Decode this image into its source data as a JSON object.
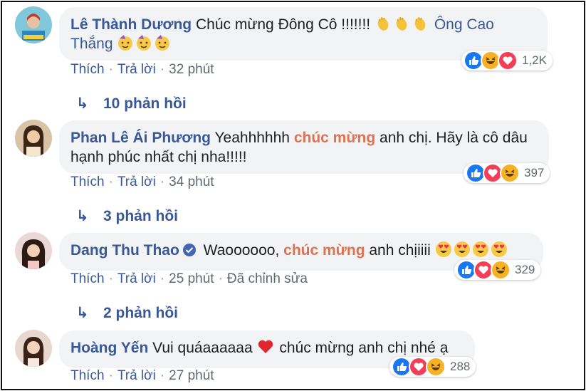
{
  "comments": [
    {
      "author": "Lê Thành Dương",
      "text_1": "Chúc mừng Đông Cô !!!!!!! ",
      "emoji_1": "clapping-hands-x3",
      "mention": "Ông Cao Thắng",
      "emoji_2": "smiling-party-face-x3",
      "like": "Thích",
      "reply": "Trả lời",
      "time": "32 phút",
      "reactions": [
        "like",
        "haha",
        "love"
      ],
      "reaction_count": "1,2K",
      "replies": "10 phản hồi"
    },
    {
      "author": "Phan Lê Ái Phương",
      "text_1": "Yeahhhhhh ",
      "highlight": "chúc mừng",
      "text_2": " anh chị. Hãy là cô dâu hạnh phúc nhất chị nha!!!!!",
      "like": "Thích",
      "reply": "Trả lời",
      "time": "34 phút",
      "reactions": [
        "like",
        "love",
        "haha"
      ],
      "reaction_count": "397",
      "replies": "3 phản hồi"
    },
    {
      "author": "Dang Thu Thao",
      "verified": true,
      "text_1": "Waoooooo, ",
      "highlight": "chúc mừng",
      "text_2": " anh chịiiii ",
      "emoji_1": "heart-eyes-x4",
      "like": "Thích",
      "reply": "Trả lời",
      "time": "25 phút",
      "edited": "Đã chỉnh sửa",
      "reactions": [
        "like",
        "love",
        "haha"
      ],
      "reaction_count": "329",
      "replies": "2 phản hồi"
    },
    {
      "author": "Hoàng Yến",
      "text_1": "Vui quáaaaaaa ",
      "emoji_1": "red-heart",
      "text_2": " chúc mừng anh chị nhé ạ",
      "like": "Thích",
      "reply": "Trả lời",
      "time": "27 phút",
      "reactions": [
        "like",
        "love",
        "haha"
      ],
      "reaction_count": "288"
    }
  ],
  "colors": {
    "author": "#385898",
    "highlight": "#e2714f",
    "bubble": "#f2f3f5",
    "meta": "#606770",
    "like_blue": "#1877f2",
    "love_red": "#f33e58",
    "haha_yellow": "#f7b125"
  }
}
